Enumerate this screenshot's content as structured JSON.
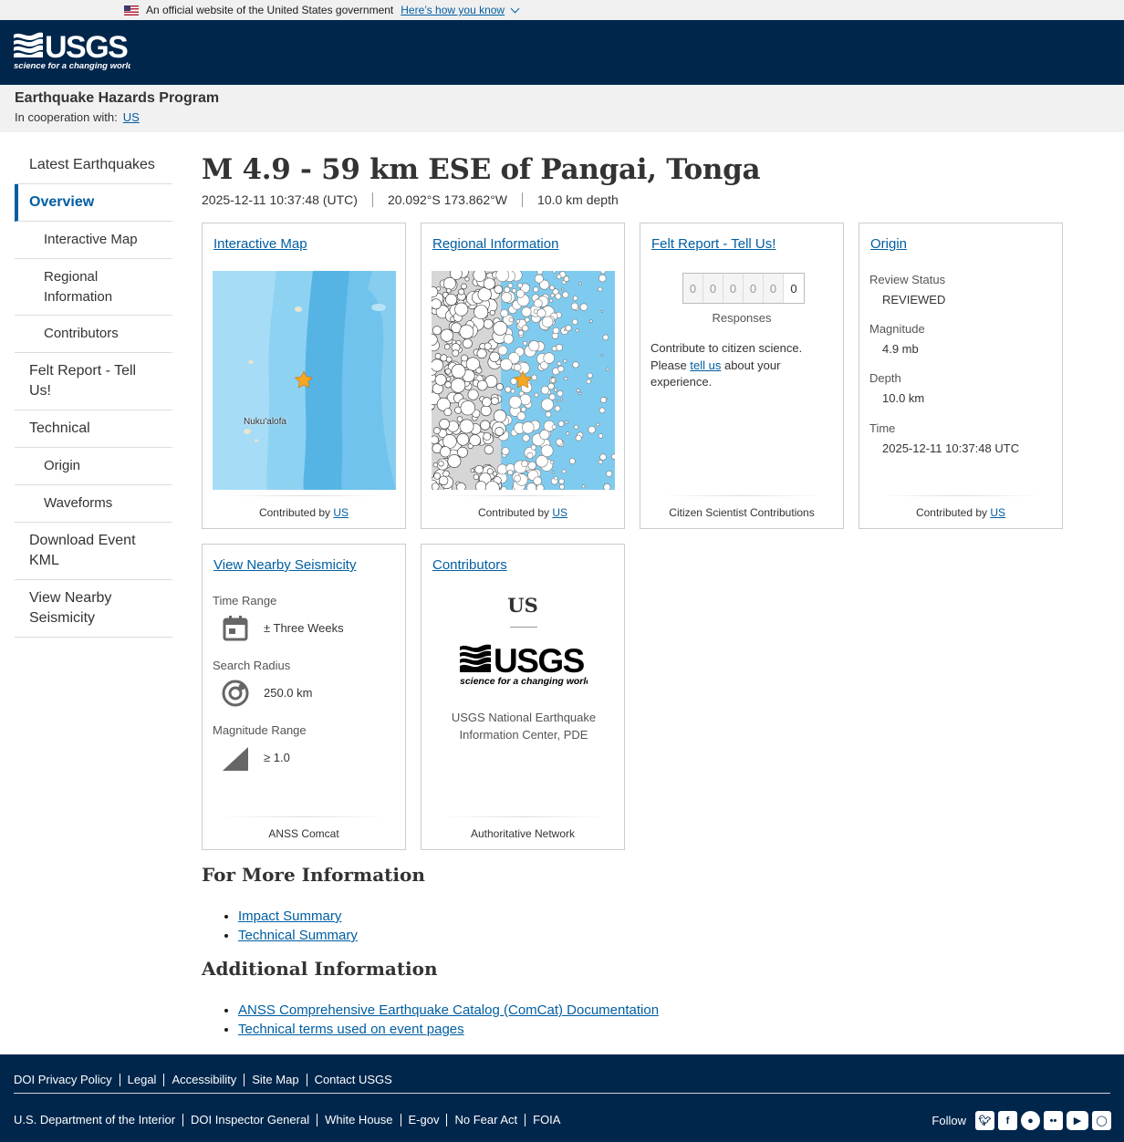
{
  "gov_banner": {
    "text": "An official website of the United States government",
    "link": "Here’s how you know"
  },
  "header": {
    "program_title": "Earthquake Hazards Program",
    "coop_label": "In cooperation with:",
    "coop_link": "US"
  },
  "sidebar": {
    "items": [
      {
        "label": "Latest Earthquakes"
      },
      {
        "label": "Overview"
      },
      {
        "label": "Interactive Map"
      },
      {
        "label": "Regional Information"
      },
      {
        "label": "Contributors"
      },
      {
        "label": "Felt Report - Tell Us!"
      },
      {
        "label": "Technical"
      },
      {
        "label": "Origin"
      },
      {
        "label": "Waveforms"
      },
      {
        "label": "Download Event KML"
      },
      {
        "label": "View Nearby Seismicity"
      }
    ]
  },
  "event": {
    "title": "M 4.9 - 59 km ESE of Pangai, Tonga",
    "time": "2025-12-11 10:37:48 (UTC)",
    "location": "20.092°S 173.862°W",
    "depth": "10.0 km depth"
  },
  "cards": {
    "interactive_map": {
      "title": "Interactive Map",
      "map_label": "Nuku'alofa",
      "footer_prefix": "Contributed by",
      "footer_link": "US"
    },
    "regional": {
      "title": "Regional Information",
      "footer_prefix": "Contributed by",
      "footer_link": "US"
    },
    "felt": {
      "title": "Felt Report - Tell Us!",
      "digits": [
        "0",
        "0",
        "0",
        "0",
        "0",
        "0"
      ],
      "responses": "Responses",
      "text_1": "Contribute to citizen science. Please",
      "link": "tell us",
      "text_2": "about your experience.",
      "footer": "Citizen Scientist Contributions"
    },
    "origin": {
      "title": "Origin",
      "review_label": "Review Status",
      "review_value": "REVIEWED",
      "mag_label": "Magnitude",
      "mag_value": "4.9 mb",
      "depth_label": "Depth",
      "depth_value": "10.0 km",
      "time_label": "Time",
      "time_value": "2025-12-11 10:37:48 UTC",
      "footer_prefix": "Contributed by",
      "footer_link": "US"
    },
    "seismicity": {
      "title": "View Nearby Seismicity",
      "time_label": "Time Range",
      "time_value": "± Three Weeks",
      "radius_label": "Search Radius",
      "radius_value": "250.0 km",
      "mag_label": "Magnitude Range",
      "mag_value": "≥ 1.0",
      "footer": "ANSS Comcat"
    },
    "contributors": {
      "title": "Contributors",
      "network": "US",
      "name": "USGS National Earthquake Information Center, PDE",
      "footer": "Authoritative Network"
    }
  },
  "more_info": {
    "heading": "For More Information",
    "links": [
      "Impact Summary",
      "Technical Summary"
    ]
  },
  "additional_info": {
    "heading": "Additional Information",
    "links": [
      "ANSS Comprehensive Earthquake Catalog (ComCat) Documentation",
      "Technical terms used on event pages"
    ]
  },
  "footer": {
    "row1": [
      "DOI Privacy Policy",
      "Legal",
      "Accessibility",
      "Site Map",
      "Contact USGS"
    ],
    "row2": [
      "U.S. Department of the Interior",
      "DOI Inspector General",
      "White House",
      "E-gov",
      "No Fear Act",
      "FOIA"
    ],
    "follow": "Follow",
    "social_icons": [
      "twitter-icon",
      "facebook-icon",
      "github-icon",
      "flickr-icon",
      "youtube-icon",
      "instagram-icon"
    ]
  },
  "colors": {
    "header_bg": "#00264c",
    "link": "#005ea2",
    "star": "#f5a623"
  }
}
